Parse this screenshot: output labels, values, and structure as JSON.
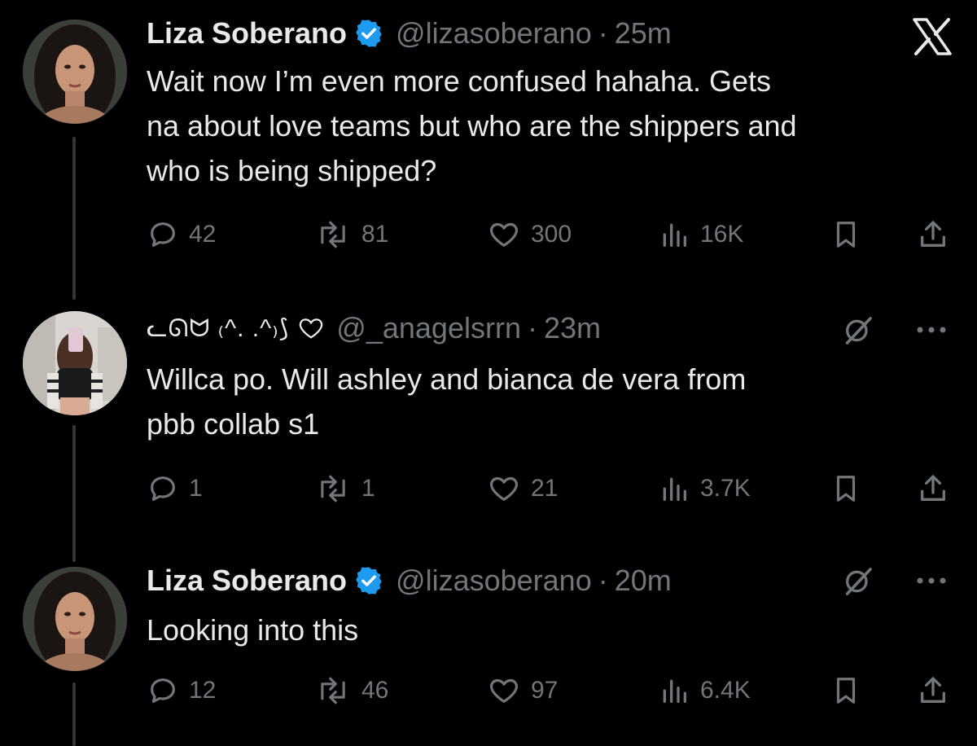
{
  "app": {
    "logo_icon": "x-logo-icon"
  },
  "tweets": [
    {
      "display_name": "Liza Soberano",
      "verified": true,
      "handle": "@lizasoberano",
      "separator": "·",
      "time": "25m",
      "text": "Wait now I’m even more confused hahaha. Gets\nna about love teams but who are the shippers and\nwho is being shipped?",
      "replies": "42",
      "reposts": "81",
      "likes": "300",
      "views": "16K"
    },
    {
      "display_name": "ᓚᘏᗢ ₍^. .^₎⟆",
      "verified": false,
      "handle": "@_anagelsrrn",
      "separator": "·",
      "time": "23m",
      "text": "Willca po. Will ashley and bianca de vera from\npbb collab s1",
      "replies": "1",
      "reposts": "1",
      "likes": "21",
      "views": "3.7K"
    },
    {
      "display_name": "Liza Soberano",
      "verified": true,
      "handle": "@lizasoberano",
      "separator": "·",
      "time": "20m",
      "text": "Looking into this",
      "replies": "12",
      "reposts": "46",
      "likes": "97",
      "views": "6.4K"
    }
  ],
  "colors": {
    "background": "#000000",
    "text": "#e7e9ea",
    "muted": "#71767b",
    "verified_blue": "#1d9bf0",
    "thread_line": "#333639"
  }
}
